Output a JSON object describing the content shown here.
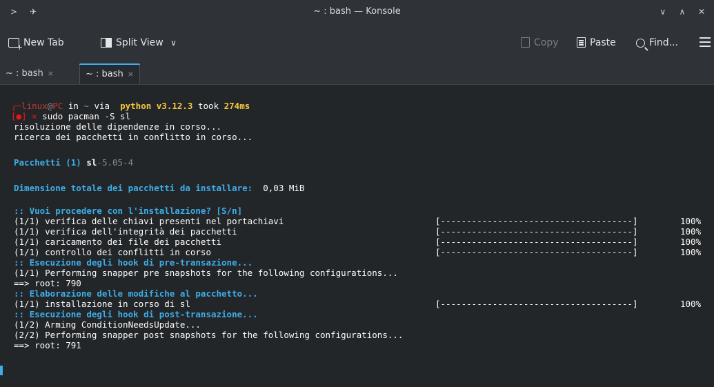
{
  "window": {
    "title": "~ : bash — Konsole"
  },
  "toolbar": {
    "new_tab": "New Tab",
    "split_view": "Split View",
    "copy": "Copy",
    "paste": "Paste",
    "find": "Find..."
  },
  "tabs": [
    {
      "label": "~ : bash",
      "close": "×"
    },
    {
      "label": "~ : bash",
      "close": "×"
    }
  ],
  "terminal": {
    "prompt": {
      "corner": "╭─",
      "user": "linux",
      "at": "@",
      "host": "PC",
      "in": " in ",
      "dir": "~",
      "via": " via ",
      "glyph": "",
      "python": " python v3.12.3",
      "took": " took ",
      "duration": "274ms",
      "status_open": "[",
      "status_dot": "●",
      "status_close": "]",
      "cross": " × ",
      "command": "sudo pacman -S sl"
    },
    "out1": "risoluzione delle dipendenze in corso...",
    "out2": "ricerca dei pacchetti in conflitto in corso...",
    "pkg_label": "Pacchetti (1)",
    "pkg_name": " sl",
    "pkg_ver": "-5.05-4",
    "size_label": "Dimensione totale dei pacchetti da installare:",
    "size_value": "  0,03 MiB",
    "q_proceed": ":: Vuoi procedere con l'installazione? [S/n]",
    "step1": "(1/1) verifica delle chiavi presenti nel portachiavi",
    "step2": "(1/1) verifica dell'integrità dei pacchetti",
    "step3": "(1/1) caricamento dei file dei pacchetti",
    "step4": "(1/1) controllo dei conflitti in corso",
    "hook_pre": ":: Esecuzione degli hook di pre-transazione...",
    "pre_snap": "(1/1) Performing snapper pre snapshots for the following configurations...",
    "root1": "==> root: 790",
    "elab": ":: Elaborazione delle modifiche al pacchetto...",
    "install": "(1/1) installazione in corso di sl",
    "hook_post": ":: Esecuzione degli hook di post-transazione...",
    "arming": "(1/2) Arming ConditionNeedsUpdate...",
    "post_snap": "(2/2) Performing snapper post snapshots for the following configurations...",
    "root2": "==> root: 791",
    "progress_bar": "[-------------------------------------]",
    "progress_pct": "100%"
  }
}
